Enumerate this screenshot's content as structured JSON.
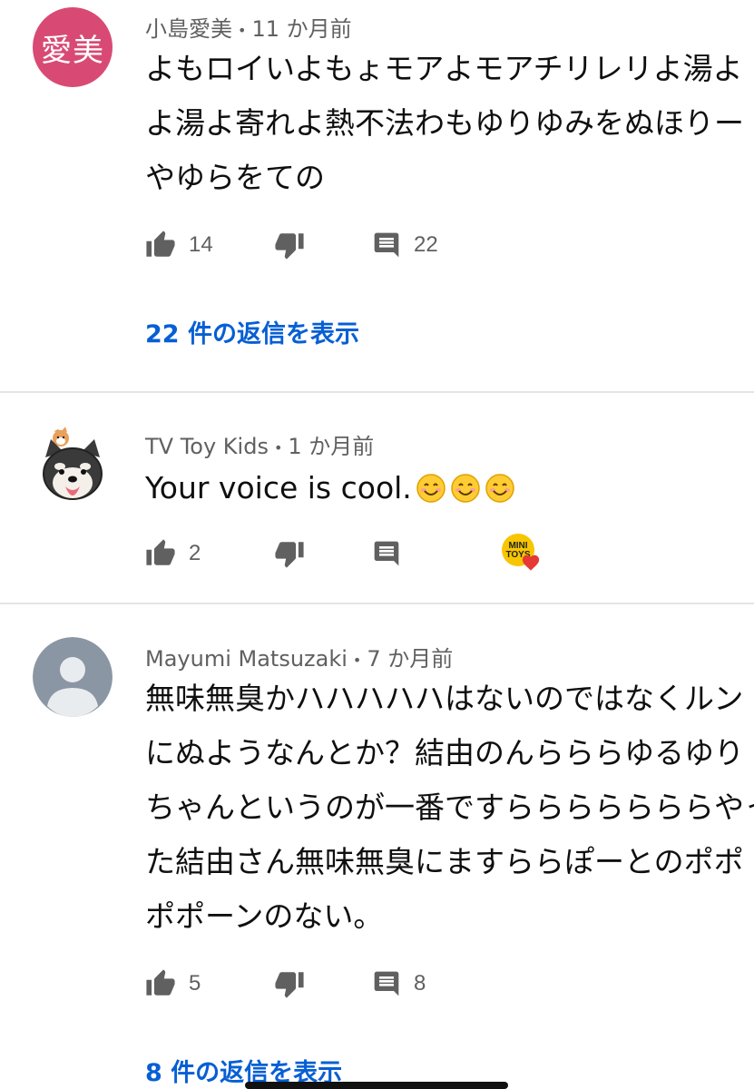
{
  "comments": [
    {
      "author": "小島愛美",
      "time": "11 か月前",
      "avatar_text": "愛美",
      "avatar_color": "#d84a74",
      "text_lines": [
        "よもロイいよもょモアよモアチリレリよ湯よ",
        "よ湯よ寄れよ熱不法わもゆりゆみをぬほりー",
        "やゆらをての"
      ],
      "likes": "14",
      "replies_count": "22",
      "view_replies": "22 件の返信を表示"
    },
    {
      "author": "TV Toy Kids",
      "time": "1 か月前",
      "avatar_icon": "shiba-dog-avatar-icon",
      "text_lines": [
        "Your voice is cool."
      ],
      "emojis": [
        "smiling-face-icon",
        "smiling-face-icon",
        "smiling-face-icon"
      ],
      "likes": "2",
      "replies_count": "",
      "hearted_by": "MINI TOYS",
      "heart_color": "#e53935"
    },
    {
      "author": "Mayumi Matsuzaki",
      "time": "7 か月前",
      "avatar_icon": "default-user-avatar-icon",
      "text_lines": [
        "無味無臭かハハハハハはないのではなくルン",
        "にぬようなんとか？結由のんらららゆるゆり",
        "ちゃんというのが一番ですらららららららやっ",
        "た結由さん無味無臭にますららぽーとのポポ",
        "ポポーンのない。"
      ],
      "likes": "5",
      "replies_count": "8",
      "view_replies": "8 件の返信を表示"
    }
  ],
  "colors": {
    "link": "#065fd4",
    "meta": "#606060",
    "divider": "#e5e5e5"
  }
}
